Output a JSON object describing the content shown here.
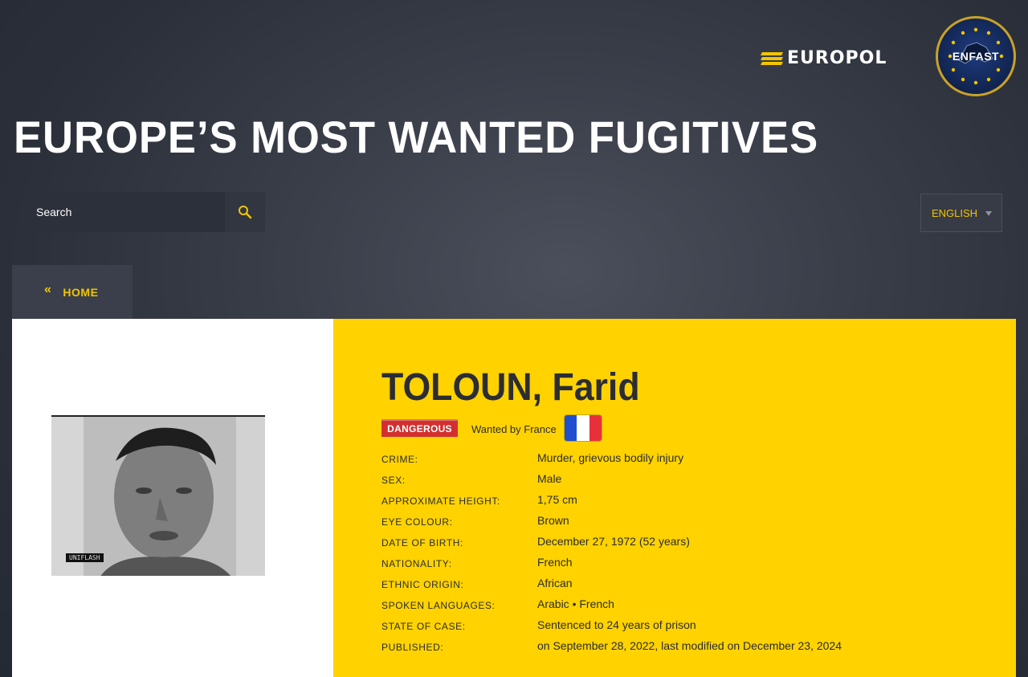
{
  "header": {
    "europol_logo_text": "EUROPOL",
    "enfast_logo_text": "ENFAST",
    "page_title": "EUROPE’S MOST WANTED FUGITIVES"
  },
  "search": {
    "placeholder": "Search",
    "icon": "search-icon"
  },
  "language": {
    "selected": "ENGLISH"
  },
  "nav": {
    "home_label": "HOME",
    "home_icon": "double-chevron-left-icon"
  },
  "profile": {
    "name": "TOLOUN, Farid",
    "badge": "DANGEROUS",
    "wanted_by": "Wanted by France",
    "flag_icon": "france-flag-icon",
    "flag_colors": [
      "#1f4fcf",
      "#ffffff",
      "#e8303a"
    ],
    "photo_label": "UNIFLASH",
    "details": [
      {
        "label": "CRIME:",
        "value": "Murder, grievous bodily injury"
      },
      {
        "label": "SEX:",
        "value": "Male"
      },
      {
        "label": "APPROXIMATE HEIGHT:",
        "value": "1,75 cm"
      },
      {
        "label": "EYE COLOUR:",
        "value": "Brown"
      },
      {
        "label": "DATE OF BIRTH:",
        "value": "December 27, 1972 (52 years)"
      },
      {
        "label": "NATIONALITY:",
        "value": "French"
      },
      {
        "label": "ETHNIC ORIGIN:",
        "value": "African"
      },
      {
        "label": "SPOKEN LANGUAGES:",
        "value": "Arabic • French"
      },
      {
        "label": "STATE OF CASE:",
        "value": "Sentenced to 24 years of prison"
      },
      {
        "label": "PUBLISHED:",
        "value": "on September 28, 2022, last modified on December 23, 2024"
      }
    ]
  },
  "colors": {
    "accent": "#ffd200",
    "danger": "#d32f2f",
    "link": "#f2c500"
  }
}
